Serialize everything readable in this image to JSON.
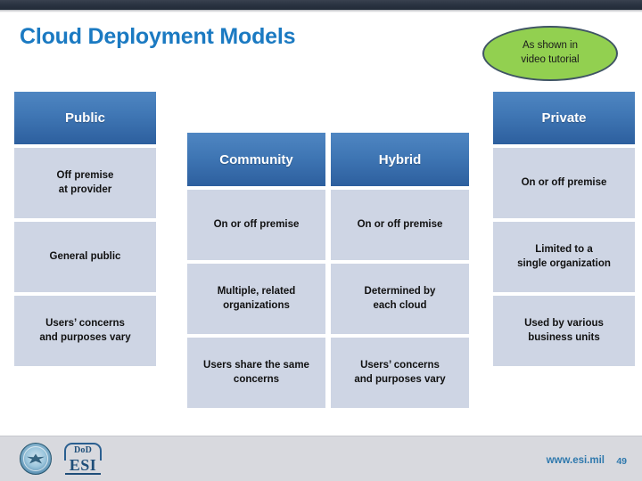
{
  "slide": {
    "title": "Cloud Deployment Models",
    "title_color": "#1b7ac2",
    "background": "#ffffff"
  },
  "callout": {
    "text": "As shown in video tutorial",
    "line1": "As shown in",
    "line2": "video tutorial",
    "fill_color": "#92d050",
    "border_color": "#3f5464"
  },
  "columns": [
    {
      "id": "public",
      "header": "Public",
      "header_color": "#3f76b4",
      "cell_color": "#ced5e4",
      "cells": [
        "Off premise\nat provider",
        "General public",
        "Users’ concerns\nand purposes vary"
      ]
    },
    {
      "id": "community",
      "header": "Community",
      "header_color": "#3f76b4",
      "cell_color": "#ced5e4",
      "cells": [
        "On or off premise",
        "Multiple, related\norganizations",
        "Users share the same\nconcerns"
      ]
    },
    {
      "id": "hybrid",
      "header": "Hybrid",
      "header_color": "#3f76b4",
      "cell_color": "#ced5e4",
      "cells": [
        "On or off premise",
        "Determined by\neach cloud",
        "Users’ concerns\nand purposes vary"
      ]
    },
    {
      "id": "private",
      "header": "Private",
      "header_color": "#3f76b4",
      "cell_color": "#ced5e4",
      "cells": [
        "On or off premise",
        "Limited to a\nsingle organization",
        "Used by various\nbusiness units"
      ]
    }
  ],
  "footer": {
    "url": "www.esi.mil",
    "page_number": "49",
    "link_color": "#2f79ad",
    "band_color": "#d8d9de",
    "logos": {
      "dod_seal": "dod-seal-icon",
      "esi_top": "DoD",
      "esi_main": "ESI"
    }
  }
}
